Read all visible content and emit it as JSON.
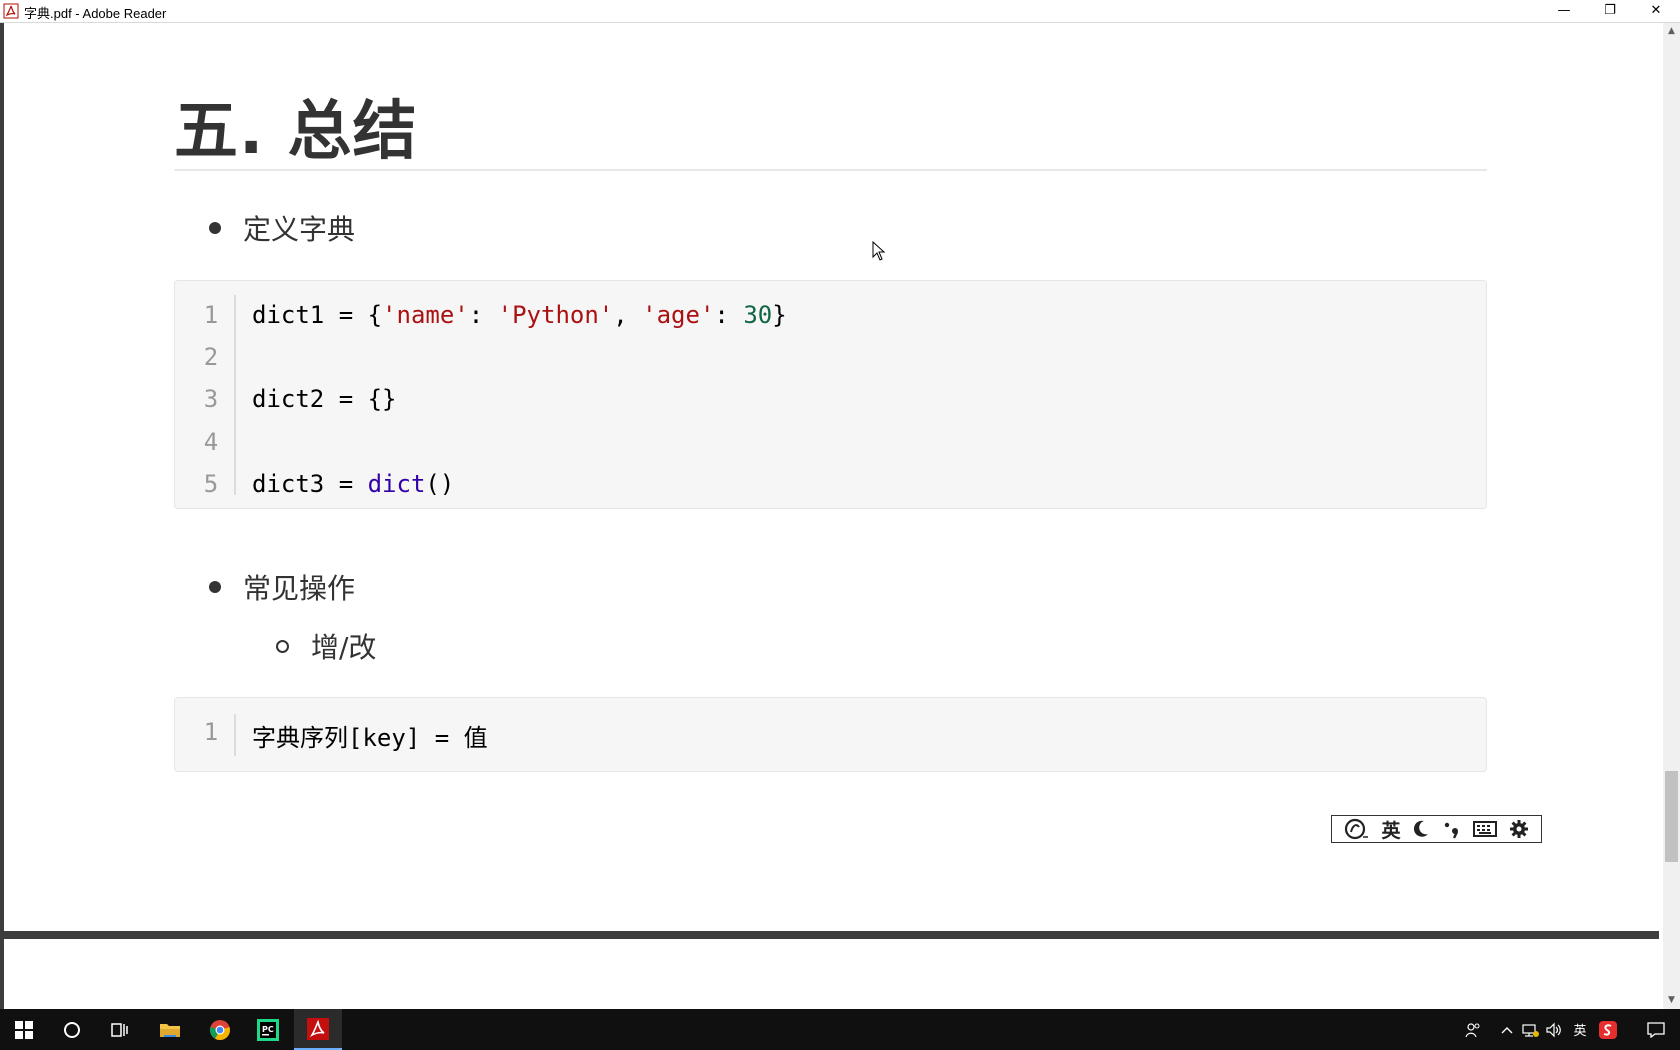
{
  "window": {
    "title": "字典.pdf - Adobe Reader",
    "minimize_glyph": "—",
    "restore_glyph": "❐",
    "close_glyph": "✕"
  },
  "document": {
    "heading": "五. 总结",
    "section1": {
      "bullet": "定义字典"
    },
    "code_block_1": {
      "line_numbers": [
        "1",
        "2",
        "3",
        "4",
        "5"
      ],
      "line1": {
        "var": "dict1 = {",
        "k1": "'name'",
        "sep1": ": ",
        "v1": "'Python'",
        "sep2": ", ",
        "k2": "'age'",
        "sep3": ": ",
        "v2": "30",
        "end": "}"
      },
      "line3": "dict2 = {}",
      "line5": {
        "var": "dict3 = ",
        "fn": "dict",
        "end": "()"
      }
    },
    "section2": {
      "bullet": "常见操作",
      "sub_bullet": "增/改"
    },
    "code_block_2": {
      "line_numbers": [
        "1"
      ],
      "line1": "字典序列[key] = 值"
    }
  },
  "ime_toolbar": {
    "mode": "英",
    "icons": [
      "sogou-logo-icon",
      "moon-icon",
      "punctuation-icon",
      "keyboard-icon",
      "gear-icon"
    ]
  },
  "taskbar": {
    "apps": [
      "windows-start-icon",
      "search-icon",
      "task-view-icon",
      "file-explorer-icon",
      "chrome-icon",
      "pycharm-icon",
      "adobe-reader-icon"
    ],
    "tray_lang": "英",
    "tray_icons": [
      "people-icon",
      "chevron-up-icon",
      "network-icon",
      "volume-icon",
      "sogou-tray-icon",
      "notification-icon"
    ]
  },
  "colors": {
    "string": "#aa1111",
    "number": "#116644",
    "builtin": "#3300aa",
    "heading": "#333333",
    "taskbar": "#101010",
    "code_bg": "#f6f6f6"
  }
}
